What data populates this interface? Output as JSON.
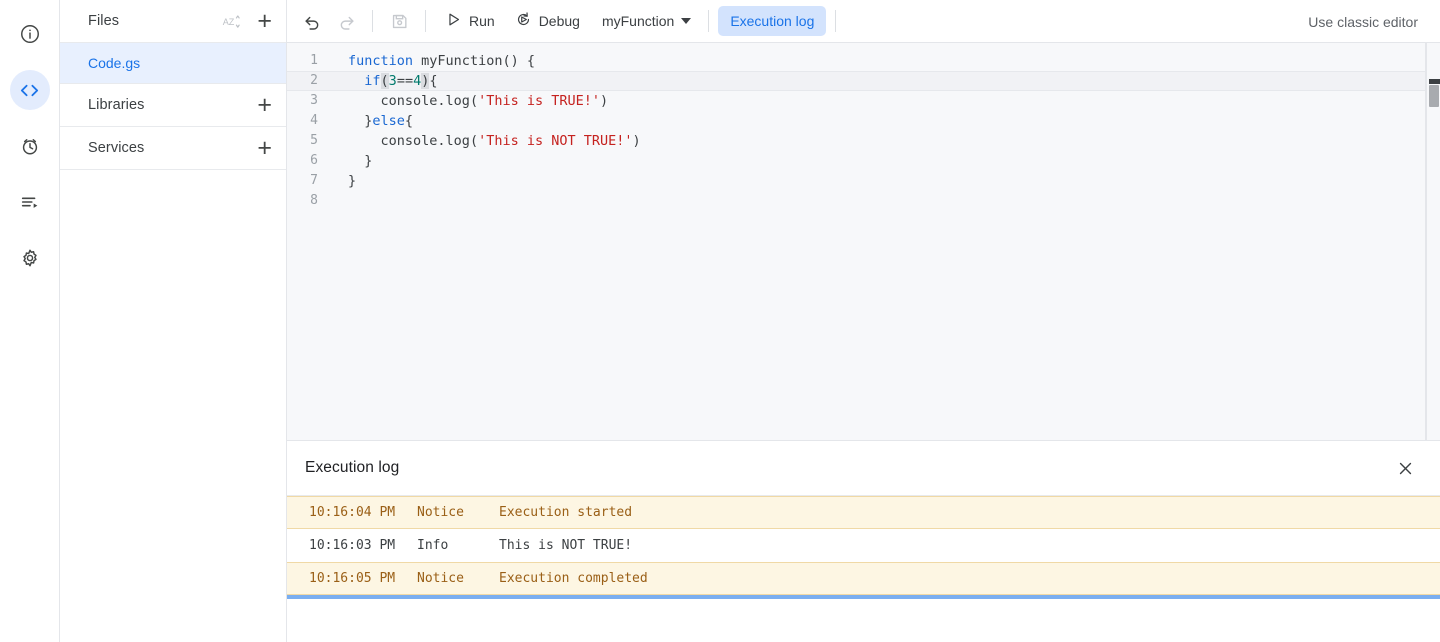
{
  "rail": {
    "items": [
      {
        "name": "overview-icon",
        "label": "Overview",
        "active": false
      },
      {
        "name": "editor-icon",
        "label": "Editor",
        "active": true
      },
      {
        "name": "triggers-icon",
        "label": "Triggers",
        "active": false
      },
      {
        "name": "executions-icon",
        "label": "Executions",
        "active": false
      },
      {
        "name": "settings-icon",
        "label": "Project Settings",
        "active": false
      }
    ]
  },
  "sidebar": {
    "files": {
      "title": "Files",
      "sort_icon": "sort-az-icon",
      "add_icon": "add-icon",
      "add_label": "+"
    },
    "file_items": [
      {
        "label": "Code.gs",
        "selected": true
      }
    ],
    "libraries": {
      "title": "Libraries",
      "add_label": "+"
    },
    "services": {
      "title": "Services",
      "add_label": "+"
    }
  },
  "toolbar": {
    "undo_label": "Undo",
    "redo_label": "Redo",
    "save_label": "Save project",
    "run_label": "Run",
    "debug_label": "Debug",
    "function_selected": "myFunction",
    "execution_log_label": "Execution log",
    "classic_editor_label": "Use classic editor"
  },
  "editor": {
    "active_line": 2,
    "lines": [
      {
        "n": "1",
        "segments": [
          {
            "t": "function",
            "c": "kw"
          },
          {
            "t": " ",
            "c": "op"
          },
          {
            "t": "myFunction",
            "c": "fnm"
          },
          {
            "t": "() {",
            "c": "op"
          }
        ]
      },
      {
        "n": "2",
        "segments": [
          {
            "t": "  ",
            "c": "op"
          },
          {
            "t": "if",
            "c": "kw"
          },
          {
            "t": "(",
            "c": "brk"
          },
          {
            "t": "3",
            "c": "num"
          },
          {
            "t": "==",
            "c": "op"
          },
          {
            "t": "4",
            "c": "num"
          },
          {
            "t": ")",
            "c": "brk"
          },
          {
            "t": "{",
            "c": "op"
          }
        ]
      },
      {
        "n": "3",
        "segments": [
          {
            "t": "    console",
            "c": "op"
          },
          {
            "t": ".",
            "c": "op"
          },
          {
            "t": "log",
            "c": "op"
          },
          {
            "t": "(",
            "c": "op"
          },
          {
            "t": "'This is TRUE!'",
            "c": "str"
          },
          {
            "t": ")",
            "c": "op"
          }
        ]
      },
      {
        "n": "4",
        "segments": [
          {
            "t": "  }",
            "c": "op"
          },
          {
            "t": "else",
            "c": "kw"
          },
          {
            "t": "{",
            "c": "op"
          }
        ]
      },
      {
        "n": "5",
        "segments": [
          {
            "t": "    console",
            "c": "op"
          },
          {
            "t": ".",
            "c": "op"
          },
          {
            "t": "log",
            "c": "op"
          },
          {
            "t": "(",
            "c": "op"
          },
          {
            "t": "'This is NOT TRUE!'",
            "c": "str"
          },
          {
            "t": ")",
            "c": "op"
          }
        ]
      },
      {
        "n": "6",
        "segments": [
          {
            "t": "  }",
            "c": "op"
          }
        ]
      },
      {
        "n": "7",
        "segments": [
          {
            "t": "}",
            "c": "op"
          }
        ]
      },
      {
        "n": "8",
        "segments": [
          {
            "t": "",
            "c": "op"
          }
        ]
      }
    ]
  },
  "log": {
    "title": "Execution log",
    "close_icon": "close-icon",
    "rows": [
      {
        "time": "10:16:04 PM",
        "level": "Notice",
        "message": "Execution started",
        "type": "notice"
      },
      {
        "time": "10:16:03 PM",
        "level": "Info",
        "message": "This is NOT TRUE!",
        "type": "info"
      },
      {
        "time": "10:16:05 PM",
        "level": "Notice",
        "message": "Execution completed",
        "type": "notice"
      }
    ]
  },
  "colors": {
    "accent_blue": "#1a73e8",
    "selected_file_bg": "#e8f0fe",
    "notice_bg": "#fdf6e3",
    "notice_text": "#9a5f16",
    "editor_bg": "#f7f8fa",
    "progress_bar": "#7aaef0"
  }
}
